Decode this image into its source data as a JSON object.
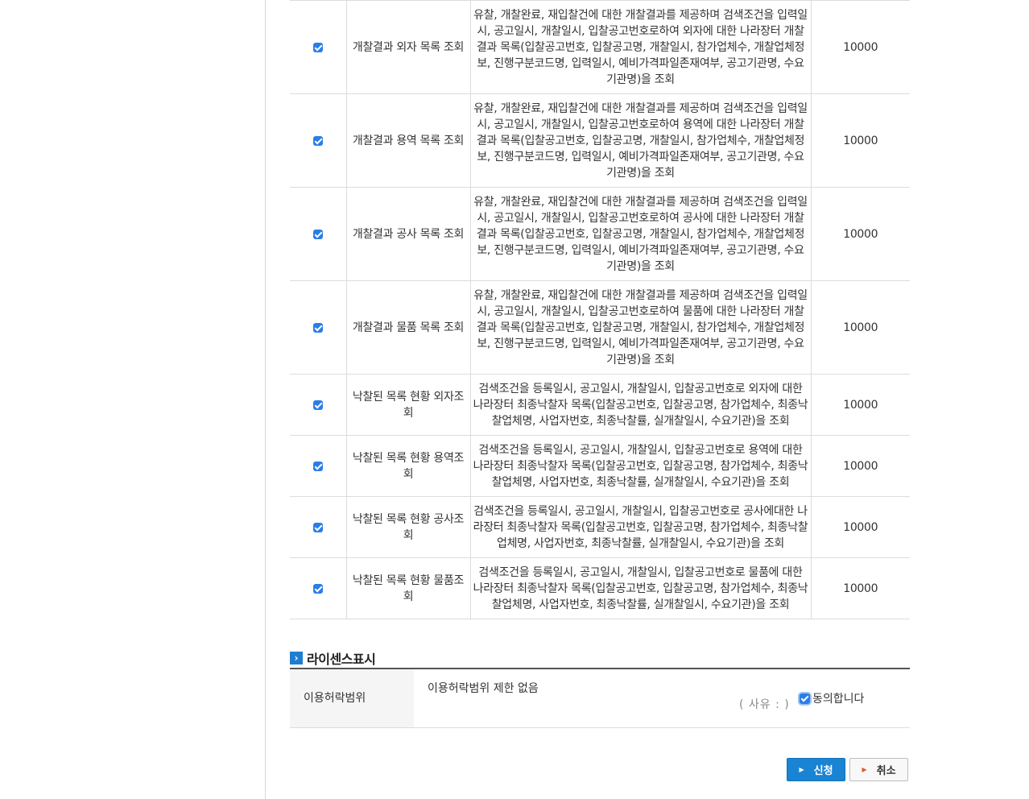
{
  "rows": [
    {
      "name": "개찰결과 외자 목록 조회",
      "desc": "유찰, 개찰완료, 재입찰건에 대한 개찰결과를 제공하며 검색조건을 입력일시, 공고일시, 개찰일시, 입찰공고번호로하여 외자에 대한 나라장터 개찰결과 목록(입찰공고번호, 입찰공고명, 개찰일시, 참가업체수, 개찰업체정보, 진행구분코드명, 입력일시, 예비가격파일존재여부, 공고기관명, 수요기관명)을 조회",
      "count": "10000",
      "checked": true
    },
    {
      "name": "개찰결과 용역 목록 조회",
      "desc": "유찰, 개찰완료, 재입찰건에 대한 개찰결과를 제공하며 검색조건을 입력일시, 공고일시, 개찰일시, 입찰공고번호로하여 용역에 대한 나라장터 개찰결과 목록(입찰공고번호, 입찰공고명, 개찰일시, 참가업체수, 개찰업체정보, 진행구분코드명, 입력일시, 예비가격파일존재여부, 공고기관명, 수요기관명)을 조회",
      "count": "10000",
      "checked": true
    },
    {
      "name": "개찰결과 공사 목록 조회",
      "desc": "유찰, 개찰완료, 재입찰건에 대한 개찰결과를 제공하며 검색조건을 입력일시, 공고일시, 개찰일시, 입찰공고번호로하여 공사에 대한 나라장터 개찰결과 목록(입찰공고번호, 입찰공고명, 개찰일시, 참가업체수, 개찰업체정보, 진행구분코드명, 입력일시, 예비가격파일존재여부, 공고기관명, 수요기관명)을 조회",
      "count": "10000",
      "checked": true
    },
    {
      "name": "개찰결과 물품 목록 조회",
      "desc": "유찰, 개찰완료, 재입찰건에 대한 개찰결과를 제공하며 검색조건을 입력일시, 공고일시, 개찰일시, 입찰공고번호로하여 물품에 대한 나라장터 개찰결과 목록(입찰공고번호, 입찰공고명, 개찰일시, 참가업체수, 개찰업체정보, 진행구분코드명, 입력일시, 예비가격파일존재여부, 공고기관명, 수요기관명)을 조회",
      "count": "10000",
      "checked": true
    },
    {
      "name": "낙찰된 목록 현황 외자조회",
      "desc": "검색조건을 등록일시, 공고일시, 개찰일시, 입찰공고번호로 외자에 대한 나라장터 최종낙찰자 목록(입찰공고번호, 입찰공고명, 참가업체수, 최종낙찰업체명, 사업자번호, 최종낙찰률, 실개찰일시, 수요기관)을 조회",
      "count": "10000",
      "checked": true
    },
    {
      "name": "낙찰된 목록 현황 용역조회",
      "desc": "검색조건을 등록일시, 공고일시, 개찰일시, 입찰공고번호로 용역에 대한 나라장터 최종낙찰자 목록(입찰공고번호, 입찰공고명, 참가업체수, 최종낙찰업체명, 사업자번호, 최종낙찰률, 실개찰일시, 수요기관)을 조회",
      "count": "10000",
      "checked": true
    },
    {
      "name": "낙찰된 목록 현황 공사조회",
      "desc": "검색조건을 등록일시, 공고일시, 개찰일시, 입찰공고번호로 공사에대한 나라장터 최종낙찰자 목록(입찰공고번호, 입찰공고명, 참가업체수, 최종낙찰업체명, 사업자번호, 최종낙찰률, 실개찰일시, 수요기관)을 조회",
      "count": "10000",
      "checked": true
    },
    {
      "name": "낙찰된 목록 현황 물품조회",
      "desc": "검색조건을 등록일시, 공고일시, 개찰일시, 입찰공고번호로 물품에 대한 나라장터 최종낙찰자 목록(입찰공고번호, 입찰공고명, 참가업체수, 최종낙찰업체명, 사업자번호, 최종낙찰률, 실개찰일시, 수요기관)을 조회",
      "count": "10000",
      "checked": true
    }
  ],
  "license": {
    "title": "라이센스표시",
    "label": "이용허락범위",
    "value": "이용허락범위 제한 없음",
    "reason": "( 사유 : )",
    "agree_label": "동의합니다",
    "agree_checked": true
  },
  "buttons": {
    "apply": "신청",
    "cancel": "취소"
  },
  "colors": {
    "accent": "#1a84d4",
    "checkbox": "#2b7de9",
    "cancel_arrow": "#e05a2b"
  }
}
